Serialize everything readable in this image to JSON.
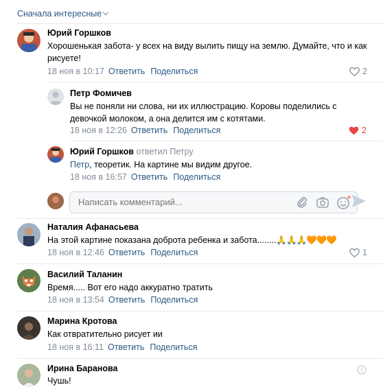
{
  "sort_label": "Сначала интересные",
  "comments": [
    {
      "author": "Юрий Горшков",
      "text": "Хорошенькая забота- у всех на виду вылить пищу на землю. Думайте, что и как рисуете!",
      "date": "18 ноя в 10:17",
      "reply": "Ответить",
      "share": "Поделиться",
      "likes": "2"
    },
    {
      "author": "Петр Фомичев",
      "text": "Вы не поняли ни слова, ни их иллюстрацию. Коровы поделились с девочкой молоком, а она делится им с котятами.",
      "date": "18 ноя в 12:26",
      "reply": "Ответить",
      "share": "Поделиться",
      "likes": "2"
    },
    {
      "author": "Юрий Горшков",
      "reply_to": "ответил Петру",
      "text_link": "Петр",
      "text": ", теоретик. На картине мы видим другое.",
      "date": "18 ноя в 16:57",
      "reply": "Ответить",
      "share": "Поделиться"
    },
    {
      "author": "Наталия Афанасьева",
      "text": "На этой картине показана доброта ребенка и забота........",
      "emojis": "🙏🙏🙏🧡🧡🧡",
      "date": "18 ноя в 12:46",
      "reply": "Ответить",
      "share": "Поделиться",
      "likes": "1"
    },
    {
      "author": "Василий Таланин",
      "text": "Время..... Вот его надо аккуратно тратить",
      "date": "18 ноя в 13:54",
      "reply": "Ответить",
      "share": "Поделиться"
    },
    {
      "author": "Марина Кротова",
      "text": "Как отвратительно рисует ии",
      "date": "18 ноя в 16:11",
      "reply": "Ответить",
      "share": "Поделиться"
    },
    {
      "author": "Ирина Баранова",
      "text": "Чушь!"
    }
  ],
  "input": {
    "placeholder": "Написать комментарий..."
  },
  "icons": {
    "heart": "heart-icon",
    "attach": "paperclip-icon",
    "camera": "camera-icon",
    "emoji": "smile-icon",
    "send": "send-icon",
    "report": "report-icon"
  },
  "colors": {
    "link": "#2a5885",
    "muted": "#818c99",
    "liked": "#e64646"
  }
}
